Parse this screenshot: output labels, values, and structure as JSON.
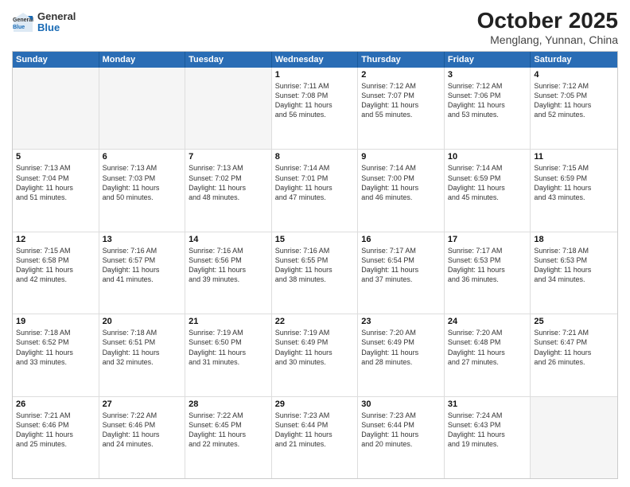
{
  "header": {
    "logo_general": "General",
    "logo_blue": "Blue",
    "title": "October 2025",
    "subtitle": "Menglang, Yunnan, China"
  },
  "days_of_week": [
    "Sunday",
    "Monday",
    "Tuesday",
    "Wednesday",
    "Thursday",
    "Friday",
    "Saturday"
  ],
  "weeks": [
    [
      {
        "day": "",
        "info": "",
        "empty": true
      },
      {
        "day": "",
        "info": "",
        "empty": true
      },
      {
        "day": "",
        "info": "",
        "empty": true
      },
      {
        "day": "1",
        "info": "Sunrise: 7:11 AM\nSunset: 7:08 PM\nDaylight: 11 hours\nand 56 minutes.",
        "empty": false
      },
      {
        "day": "2",
        "info": "Sunrise: 7:12 AM\nSunset: 7:07 PM\nDaylight: 11 hours\nand 55 minutes.",
        "empty": false
      },
      {
        "day": "3",
        "info": "Sunrise: 7:12 AM\nSunset: 7:06 PM\nDaylight: 11 hours\nand 53 minutes.",
        "empty": false
      },
      {
        "day": "4",
        "info": "Sunrise: 7:12 AM\nSunset: 7:05 PM\nDaylight: 11 hours\nand 52 minutes.",
        "empty": false
      }
    ],
    [
      {
        "day": "5",
        "info": "Sunrise: 7:13 AM\nSunset: 7:04 PM\nDaylight: 11 hours\nand 51 minutes.",
        "empty": false
      },
      {
        "day": "6",
        "info": "Sunrise: 7:13 AM\nSunset: 7:03 PM\nDaylight: 11 hours\nand 50 minutes.",
        "empty": false
      },
      {
        "day": "7",
        "info": "Sunrise: 7:13 AM\nSunset: 7:02 PM\nDaylight: 11 hours\nand 48 minutes.",
        "empty": false
      },
      {
        "day": "8",
        "info": "Sunrise: 7:14 AM\nSunset: 7:01 PM\nDaylight: 11 hours\nand 47 minutes.",
        "empty": false
      },
      {
        "day": "9",
        "info": "Sunrise: 7:14 AM\nSunset: 7:00 PM\nDaylight: 11 hours\nand 46 minutes.",
        "empty": false
      },
      {
        "day": "10",
        "info": "Sunrise: 7:14 AM\nSunset: 6:59 PM\nDaylight: 11 hours\nand 45 minutes.",
        "empty": false
      },
      {
        "day": "11",
        "info": "Sunrise: 7:15 AM\nSunset: 6:59 PM\nDaylight: 11 hours\nand 43 minutes.",
        "empty": false
      }
    ],
    [
      {
        "day": "12",
        "info": "Sunrise: 7:15 AM\nSunset: 6:58 PM\nDaylight: 11 hours\nand 42 minutes.",
        "empty": false
      },
      {
        "day": "13",
        "info": "Sunrise: 7:16 AM\nSunset: 6:57 PM\nDaylight: 11 hours\nand 41 minutes.",
        "empty": false
      },
      {
        "day": "14",
        "info": "Sunrise: 7:16 AM\nSunset: 6:56 PM\nDaylight: 11 hours\nand 39 minutes.",
        "empty": false
      },
      {
        "day": "15",
        "info": "Sunrise: 7:16 AM\nSunset: 6:55 PM\nDaylight: 11 hours\nand 38 minutes.",
        "empty": false
      },
      {
        "day": "16",
        "info": "Sunrise: 7:17 AM\nSunset: 6:54 PM\nDaylight: 11 hours\nand 37 minutes.",
        "empty": false
      },
      {
        "day": "17",
        "info": "Sunrise: 7:17 AM\nSunset: 6:53 PM\nDaylight: 11 hours\nand 36 minutes.",
        "empty": false
      },
      {
        "day": "18",
        "info": "Sunrise: 7:18 AM\nSunset: 6:53 PM\nDaylight: 11 hours\nand 34 minutes.",
        "empty": false
      }
    ],
    [
      {
        "day": "19",
        "info": "Sunrise: 7:18 AM\nSunset: 6:52 PM\nDaylight: 11 hours\nand 33 minutes.",
        "empty": false
      },
      {
        "day": "20",
        "info": "Sunrise: 7:18 AM\nSunset: 6:51 PM\nDaylight: 11 hours\nand 32 minutes.",
        "empty": false
      },
      {
        "day": "21",
        "info": "Sunrise: 7:19 AM\nSunset: 6:50 PM\nDaylight: 11 hours\nand 31 minutes.",
        "empty": false
      },
      {
        "day": "22",
        "info": "Sunrise: 7:19 AM\nSunset: 6:49 PM\nDaylight: 11 hours\nand 30 minutes.",
        "empty": false
      },
      {
        "day": "23",
        "info": "Sunrise: 7:20 AM\nSunset: 6:49 PM\nDaylight: 11 hours\nand 28 minutes.",
        "empty": false
      },
      {
        "day": "24",
        "info": "Sunrise: 7:20 AM\nSunset: 6:48 PM\nDaylight: 11 hours\nand 27 minutes.",
        "empty": false
      },
      {
        "day": "25",
        "info": "Sunrise: 7:21 AM\nSunset: 6:47 PM\nDaylight: 11 hours\nand 26 minutes.",
        "empty": false
      }
    ],
    [
      {
        "day": "26",
        "info": "Sunrise: 7:21 AM\nSunset: 6:46 PM\nDaylight: 11 hours\nand 25 minutes.",
        "empty": false
      },
      {
        "day": "27",
        "info": "Sunrise: 7:22 AM\nSunset: 6:46 PM\nDaylight: 11 hours\nand 24 minutes.",
        "empty": false
      },
      {
        "day": "28",
        "info": "Sunrise: 7:22 AM\nSunset: 6:45 PM\nDaylight: 11 hours\nand 22 minutes.",
        "empty": false
      },
      {
        "day": "29",
        "info": "Sunrise: 7:23 AM\nSunset: 6:44 PM\nDaylight: 11 hours\nand 21 minutes.",
        "empty": false
      },
      {
        "day": "30",
        "info": "Sunrise: 7:23 AM\nSunset: 6:44 PM\nDaylight: 11 hours\nand 20 minutes.",
        "empty": false
      },
      {
        "day": "31",
        "info": "Sunrise: 7:24 AM\nSunset: 6:43 PM\nDaylight: 11 hours\nand 19 minutes.",
        "empty": false
      },
      {
        "day": "",
        "info": "",
        "empty": true
      }
    ]
  ]
}
